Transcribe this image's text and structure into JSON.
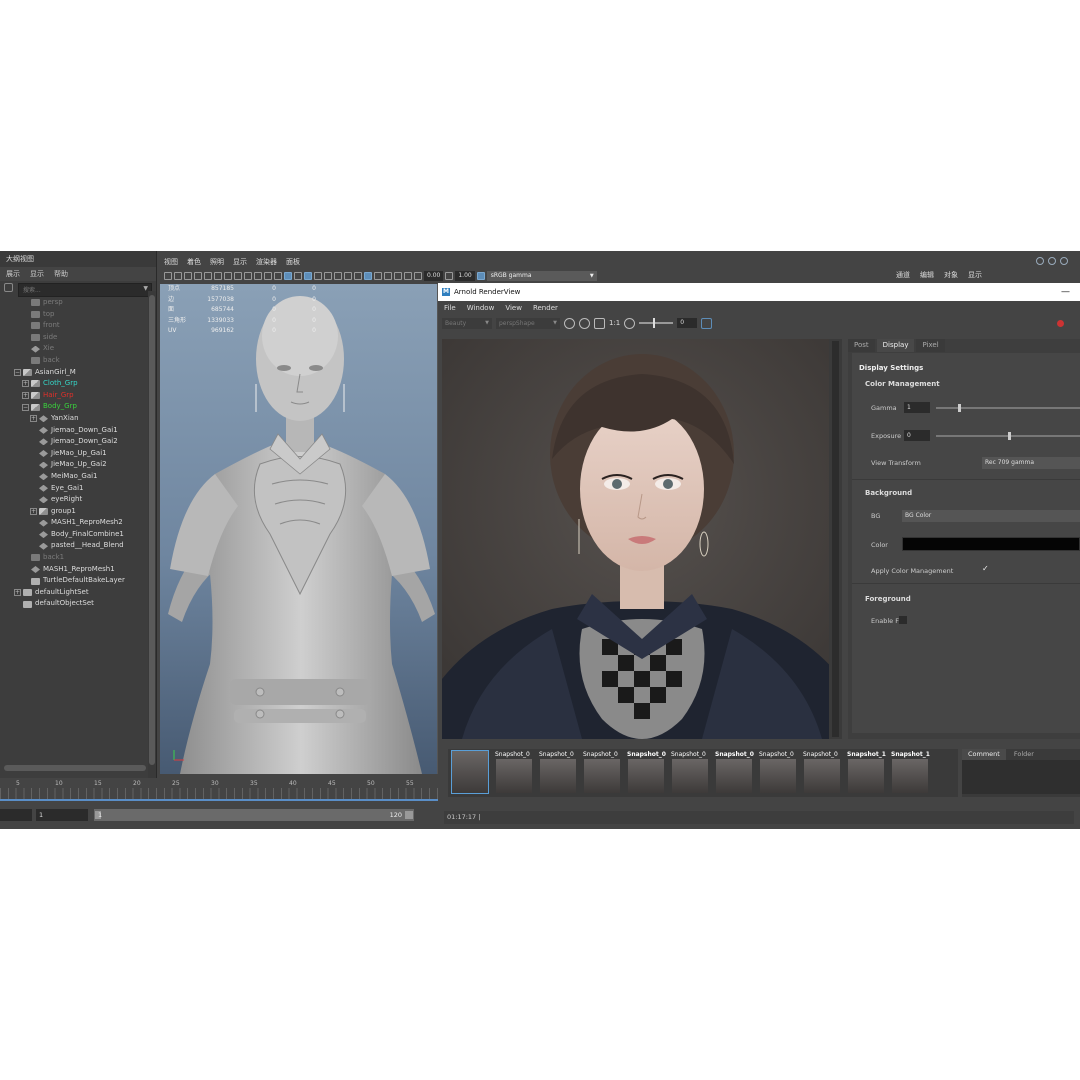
{
  "outliner": {
    "title": "大纲视图",
    "menu": [
      "展示",
      "显示",
      "帮助"
    ],
    "search_placeholder": "搜索...",
    "items": [
      {
        "label": "persp",
        "color": "#7c7c7c",
        "indent": 1,
        "icon": "camera-icon",
        "expand": ""
      },
      {
        "label": "top",
        "color": "#7c7c7c",
        "indent": 1,
        "icon": "camera-icon",
        "expand": ""
      },
      {
        "label": "front",
        "color": "#7c7c7c",
        "indent": 1,
        "icon": "camera-icon",
        "expand": ""
      },
      {
        "label": "side",
        "color": "#7c7c7c",
        "indent": 1,
        "icon": "camera-icon",
        "expand": ""
      },
      {
        "label": "Xie",
        "color": "#7c7c7c",
        "indent": 1,
        "icon": "mesh-icon",
        "expand": ""
      },
      {
        "label": "back",
        "color": "#7c7c7c",
        "indent": 1,
        "icon": "camera-icon",
        "expand": ""
      },
      {
        "label": "AsianGirl_M",
        "color": "#dddddd",
        "indent": 0,
        "icon": "group-icon",
        "expand": "−"
      },
      {
        "label": "Cloth_Grp",
        "color": "#35d6c8",
        "indent": 1,
        "icon": "group-icon",
        "expand": "+"
      },
      {
        "label": "Hair_Grp",
        "color": "#e0302a",
        "indent": 1,
        "icon": "group-icon",
        "expand": "+"
      },
      {
        "label": "Body_Grp",
        "color": "#39d23c",
        "indent": 1,
        "icon": "group-icon",
        "expand": "−"
      },
      {
        "label": "YanXian",
        "color": "#dddddd",
        "indent": 2,
        "icon": "mesh-icon",
        "expand": "+"
      },
      {
        "label": "Jiemao_Down_Gai1",
        "color": "#dddddd",
        "indent": 2,
        "icon": "mesh-icon",
        "expand": ""
      },
      {
        "label": "Jiemao_Down_Gai2",
        "color": "#dddddd",
        "indent": 2,
        "icon": "mesh-icon",
        "expand": ""
      },
      {
        "label": "JieMao_Up_Gai1",
        "color": "#dddddd",
        "indent": 2,
        "icon": "mesh-icon",
        "expand": ""
      },
      {
        "label": "JieMao_Up_Gai2",
        "color": "#dddddd",
        "indent": 2,
        "icon": "mesh-icon",
        "expand": ""
      },
      {
        "label": "MeiMao_Gai1",
        "color": "#dddddd",
        "indent": 2,
        "icon": "mesh-icon",
        "expand": ""
      },
      {
        "label": "Eye_Gai1",
        "color": "#dddddd",
        "indent": 2,
        "icon": "mesh-icon",
        "expand": ""
      },
      {
        "label": "eyeRight",
        "color": "#dddddd",
        "indent": 2,
        "icon": "mesh-icon",
        "expand": ""
      },
      {
        "label": "group1",
        "color": "#dddddd",
        "indent": 2,
        "icon": "group-icon",
        "expand": "+"
      },
      {
        "label": "MASH1_ReproMesh2",
        "color": "#dddddd",
        "indent": 2,
        "icon": "mesh-icon",
        "expand": ""
      },
      {
        "label": "Body_FinalCombine1",
        "color": "#dddddd",
        "indent": 2,
        "icon": "mesh-icon",
        "expand": ""
      },
      {
        "label": "pasted__Head_Blend",
        "color": "#dddddd",
        "indent": 2,
        "icon": "mesh-icon",
        "expand": ""
      },
      {
        "label": "back1",
        "color": "#7c7c7c",
        "indent": 1,
        "icon": "camera-icon",
        "expand": ""
      },
      {
        "label": "MASH1_ReproMesh1",
        "color": "#dddddd",
        "indent": 1,
        "icon": "mesh-icon",
        "expand": ""
      },
      {
        "label": "TurtleDefaultBakeLayer",
        "color": "#dddddd",
        "indent": 1,
        "icon": "set-icon",
        "expand": ""
      },
      {
        "label": "defaultLightSet",
        "color": "#dddddd",
        "indent": 0,
        "icon": "set-icon",
        "expand": "+"
      },
      {
        "label": "defaultObjectSet",
        "color": "#dddddd",
        "indent": 0,
        "icon": "set-icon",
        "expand": ""
      }
    ]
  },
  "viewport": {
    "menu": [
      "视图",
      "着色",
      "照明",
      "显示",
      "渲染器",
      "面板"
    ],
    "toolbar_value_1": "0.00",
    "toolbar_value_2": "1.00",
    "color_space": "sRGB gamma",
    "hud": [
      {
        "key": "顶点",
        "value": "857185",
        "z1": "0",
        "z2": "0"
      },
      {
        "key": "边",
        "value": "1577038",
        "z1": "0",
        "z2": "0"
      },
      {
        "key": "面",
        "value": "685744",
        "z1": "0",
        "z2": "0"
      },
      {
        "key": "三角形",
        "value": "1339033",
        "z1": "0",
        "z2": "0"
      },
      {
        "key": "UV",
        "value": "969162",
        "z1": "0",
        "z2": "0"
      }
    ]
  },
  "channel_box": {
    "menu": [
      "通道",
      "编辑",
      "对象",
      "显示"
    ]
  },
  "render_view": {
    "title": "Arnold RenderView",
    "menu": [
      "File",
      "Window",
      "View",
      "Render"
    ],
    "status_dropdown": "Beauty",
    "camera_dropdown": "perspShape",
    "ratio": "1:1",
    "exposure_field": "0",
    "side_tabs": [
      "Post",
      "Display",
      "Pixel"
    ],
    "active_tab": "Display",
    "display_settings": {
      "heading": "Display Settings",
      "color_management": "Color Management",
      "gamma_label": "Gamma",
      "gamma_value": "1",
      "gamma_level": 0.15,
      "exposure_label": "Exposure",
      "exposure_value": "0",
      "exposure_level": 0.5,
      "view_transform_label": "View Transform",
      "view_transform_value": "Rec 709 gamma",
      "background": "Background",
      "bg_label": "BG",
      "bg_value": "BG Color",
      "color_label": "Color",
      "color_value": "#050505",
      "apply_cm_label": "Apply Color Management",
      "apply_cm_checked": "✓",
      "foreground": "Foreground",
      "enable_label": "Enable F"
    },
    "snapshots": [
      {
        "label": "Snapshot_0",
        "bold": false
      },
      {
        "label": "Snapshot_0",
        "bold": false
      },
      {
        "label": "Snapshot_0",
        "bold": false
      },
      {
        "label": "Snapshot_0",
        "bold": true
      },
      {
        "label": "Snapshot_0",
        "bold": false
      },
      {
        "label": "Snapshot_0",
        "bold": true
      },
      {
        "label": "Snapshot_0",
        "bold": false
      },
      {
        "label": "Snapshot_0",
        "bold": false
      },
      {
        "label": "Snapshot_1",
        "bold": true
      },
      {
        "label": "Snapshot_1",
        "bold": true
      },
      {
        "label": "Snapshot_1",
        "bold": false
      }
    ],
    "snapshot_tabs": [
      "Comment",
      "Folder"
    ],
    "status": "01:17:17 |"
  },
  "timeline": {
    "ticks": [
      "5",
      "10",
      "15",
      "20",
      "25",
      "30",
      "35",
      "40",
      "45",
      "50",
      "55"
    ],
    "current_frame": "1",
    "range_start": "1",
    "range_end": "120"
  }
}
